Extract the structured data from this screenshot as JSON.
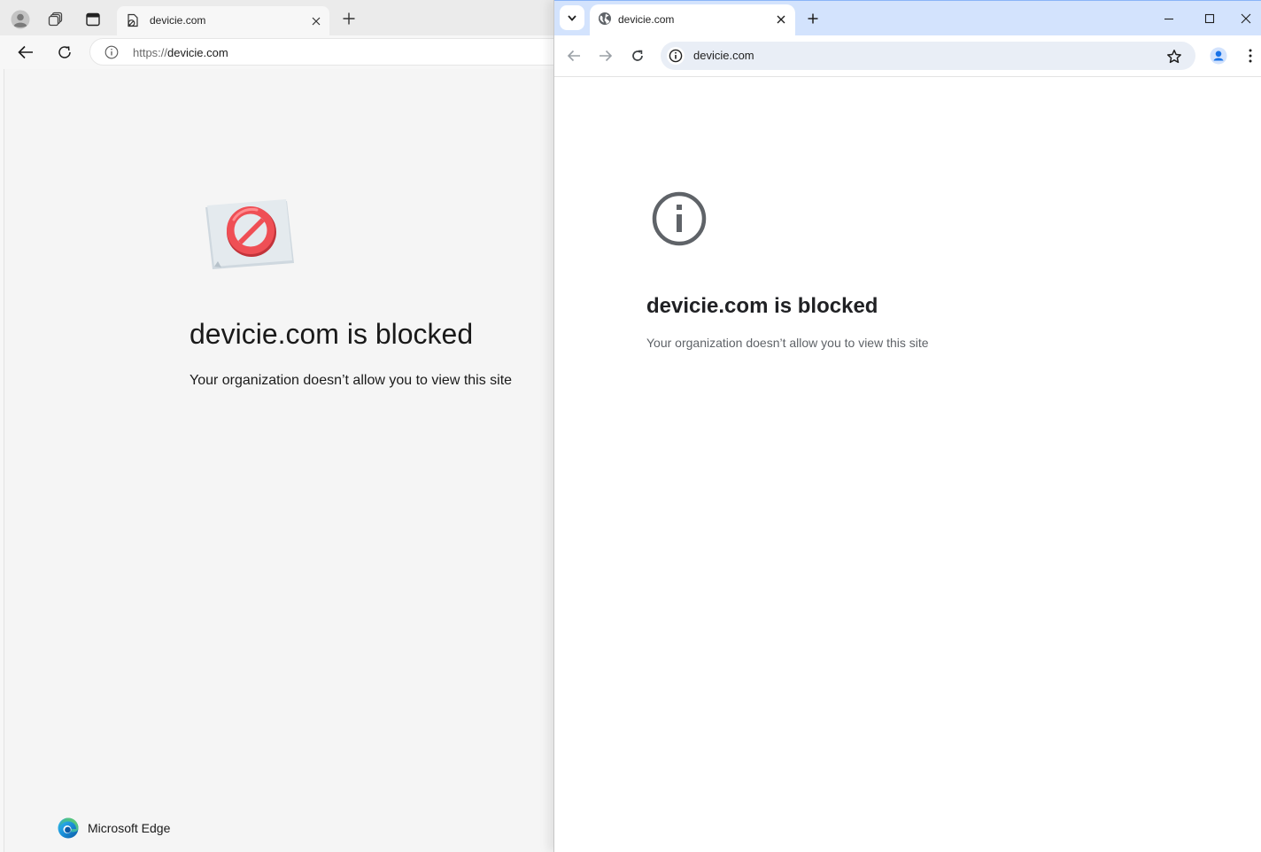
{
  "edge": {
    "tab": {
      "title": "devicie.com"
    },
    "address": {
      "scheme": "https://",
      "host": "devicie.com"
    },
    "page": {
      "heading": "devicie.com is blocked",
      "subtext": "Your organization doesn’t allow you to view this site"
    },
    "brand": {
      "label": "Microsoft Edge"
    },
    "icons": [
      "profile-icon",
      "workspaces-icon",
      "vertical-tabs-icon",
      "tab-blocked-favicon-icon",
      "close-icon",
      "plus-icon",
      "back-arrow-icon",
      "reload-icon",
      "info-icon",
      "blocked-sign-icon",
      "edge-logo-icon"
    ]
  },
  "chrome": {
    "tab": {
      "title": "devicie.com"
    },
    "address": {
      "url": "devicie.com"
    },
    "page": {
      "heading": "devicie.com is blocked",
      "subtext": "Your organization doesn’t allow you to view this site"
    },
    "icons": [
      "chevron-down-icon",
      "globe-icon",
      "close-icon",
      "plus-icon",
      "minimize-icon",
      "maximize-icon",
      "window-close-icon",
      "back-arrow-icon",
      "forward-arrow-icon",
      "reload-icon",
      "info-icon",
      "star-icon",
      "profile-icon",
      "kebab-menu-icon",
      "info-large-icon"
    ]
  },
  "colors": {
    "edge_tabstrip": "#ebebeb",
    "edge_content": "#f5f5f5",
    "chrome_tabstrip": "#d3e3fd",
    "chrome_omnibox": "#e9eef6",
    "blocked_red": "#e8434a",
    "profile_blue": "#1a73e8"
  }
}
